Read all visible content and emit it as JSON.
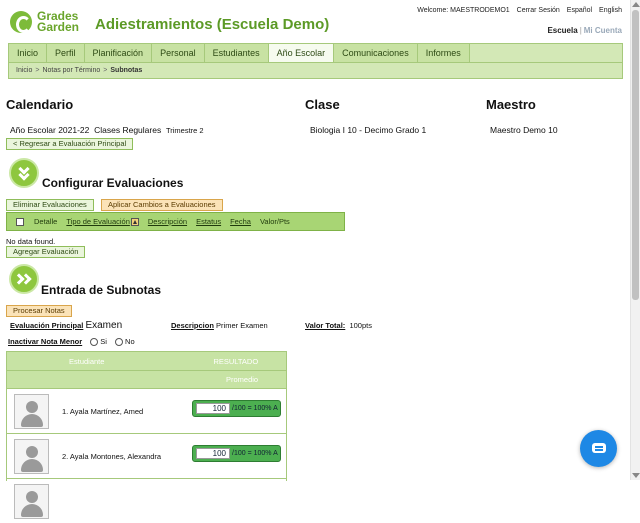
{
  "logo": {
    "line1": "Grades",
    "line2": "Garden"
  },
  "app_title": "Adiestramientos (Escuela Demo)",
  "topbar": {
    "welcome": "Welcome: MAESTRODEMO1",
    "logout": "Cerrar Sesión",
    "lang_es": "Español",
    "lang_en": "English"
  },
  "school_switch": {
    "current": "Escuela",
    "sep": "|",
    "other": "Mi Cuenta"
  },
  "nav": {
    "tabs": [
      "Inicio",
      "Perfil",
      "Planificación",
      "Personal",
      "Estudiantes",
      "Año Escolar",
      "Comunicaciones",
      "Informes"
    ],
    "active": "Año Escolar"
  },
  "breadcrumb": {
    "items": [
      "Inicio",
      "Notas por Término",
      "Subnotas"
    ],
    "sep": ">"
  },
  "headers": {
    "calendar": "Calendario",
    "class": "Clase",
    "teacher": "Maestro"
  },
  "info": {
    "school_year": "Año Escolar 2021-22",
    "class_type": "Clases Regulares",
    "term": "Trimestre 2",
    "class_name": "Biologia I 10 -  Decimo Grado  1",
    "teacher_name": "Maestro Demo 10"
  },
  "buttons": {
    "back": "< Regresar a Evaluación Principal",
    "delete_evals": "Eliminar Evaluaciones",
    "apply_changes": "Aplicar Cambios a Evaluaciones",
    "add_eval": "Agregar Evaluación",
    "process_grades": "Procesar Notas"
  },
  "configure": {
    "title": "Configurar Evaluaciones",
    "columns": [
      "Detalle",
      "Tipo de Evaluación",
      "Descripción",
      "Estatus",
      "Fecha",
      "Valor/Pts"
    ],
    "no_data": "No data found."
  },
  "subgrades": {
    "title": "Entrada de Subnotas",
    "main_eval_label": "Evaluación Principal",
    "main_eval_value": "Examen",
    "desc_label": "Descripcion",
    "desc_value": "Primer Examen",
    "total_label": "Valor Total:",
    "total_value": "100pts",
    "inactivate_label": "Inactivar Nota Menor",
    "opt_yes": "Si",
    "opt_no": "No",
    "col_student": "Estudiante",
    "col_result": "RESULTADO",
    "col_avg": "Promedio",
    "students": [
      {
        "name": "1. Ayala Martínez, Amed",
        "score": "100",
        "result": "/100 = 100% A"
      },
      {
        "name": "2. Ayala Montones, Alexandra",
        "score": "100",
        "result": "/100 = 100% A"
      }
    ]
  },
  "colors": {
    "accent": "#8ec73e",
    "nav_bg": "#d3e8b6",
    "grade_ok": "#4caf50",
    "chat": "#1e88e5"
  },
  "icons": {
    "section_configure": "double-chevron-down-icon",
    "section_subgrades": "double-chevron-right-icon",
    "chat": "chat-icon",
    "sort": "sort-asc-icon"
  }
}
